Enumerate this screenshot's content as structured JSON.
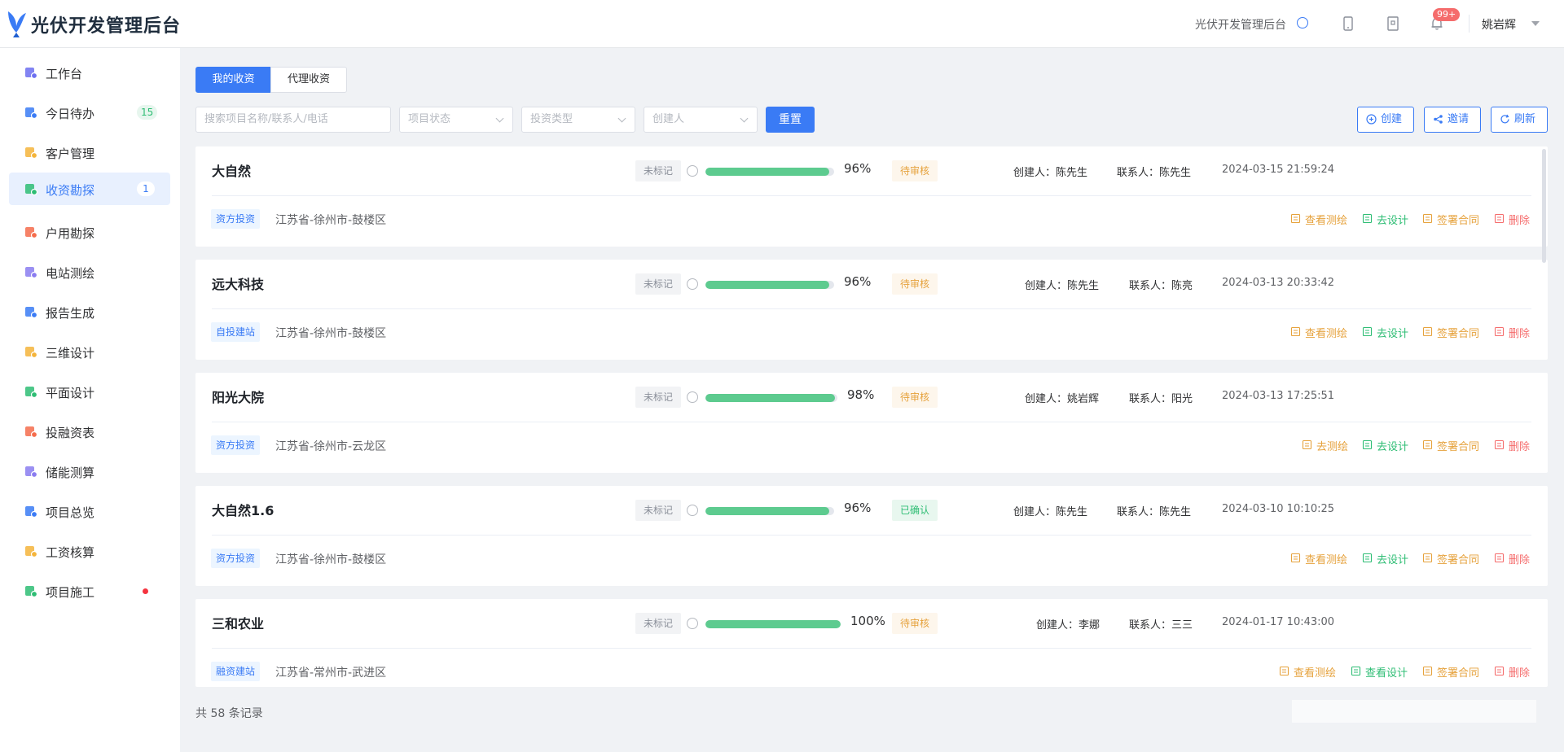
{
  "app": {
    "title": "光伏开发管理后台",
    "system_name": "光伏开发管理后台",
    "notification_badge": "99+",
    "user_name": "姚岩辉"
  },
  "sidebar": {
    "items": [
      {
        "label": "工作台",
        "icon": "home-icon",
        "color": "#6c6ff0"
      },
      {
        "label": "今日待办",
        "icon": "todo-icon",
        "color": "#3a7bf5",
        "count": "15"
      },
      {
        "label": "客户管理",
        "icon": "customer-icon",
        "color": "#f4b43b"
      },
      {
        "label": "收资勘探",
        "icon": "survey-doc-icon",
        "color": "#2ebd74",
        "count": "1"
      },
      {
        "label": "户用勘探",
        "icon": "household-icon",
        "color": "#f56c4c"
      },
      {
        "label": "电站测绘",
        "icon": "station-map-icon",
        "color": "#8a7cf0"
      },
      {
        "label": "报告生成",
        "icon": "report-icon",
        "color": "#3a7bf5"
      },
      {
        "label": "三维设计",
        "icon": "cube-icon",
        "color": "#f4b43b"
      },
      {
        "label": "平面设计",
        "icon": "layout-icon",
        "color": "#2ebd74"
      },
      {
        "label": "投融资表",
        "icon": "finance-icon",
        "color": "#f56c4c"
      },
      {
        "label": "储能测算",
        "icon": "calculator-icon",
        "color": "#8a7cf0"
      },
      {
        "label": "项目总览",
        "icon": "layers-icon",
        "color": "#3a7bf5"
      },
      {
        "label": "工资核算",
        "icon": "salary-icon",
        "color": "#f4b43b"
      },
      {
        "label": "项目施工",
        "icon": "construction-icon",
        "color": "#2ebd74"
      }
    ]
  },
  "tabs": [
    {
      "label": "我的收资"
    },
    {
      "label": "代理收资"
    }
  ],
  "filters": {
    "search_placeholder": "搜索项目名称/联系人/电话",
    "status_placeholder": "项目状态",
    "invest_placeholder": "投资类型",
    "creator_placeholder": "创建人",
    "reset_label": "重置",
    "create_label": "创建",
    "invite_label": "邀请",
    "refresh_label": "刷新"
  },
  "projects": [
    {
      "name": "大自然",
      "mark": "未标记",
      "progress": 0.96,
      "progress_text": "96%",
      "status": "待审核",
      "status_type": "pending",
      "creator": "创建人：陈先生",
      "contact": "联系人：陈先生",
      "date": "2024-03-15 21:59:24",
      "invest_type": "资方投资",
      "address": "江苏省-徐州市-鼓楼区",
      "actions": [
        "查看测绘",
        "去设计",
        "签署合同",
        "删除"
      ]
    },
    {
      "name": "远大科技",
      "mark": "未标记",
      "progress": 0.96,
      "progress_text": "96%",
      "status": "待审核",
      "status_type": "pending",
      "creator": "创建人：陈先生",
      "contact": "联系人：陈亮",
      "date": "2024-03-13 20:33:42",
      "invest_type": "自投建站",
      "address": "江苏省-徐州市-鼓楼区",
      "actions": [
        "查看测绘",
        "去设计",
        "签署合同",
        "删除"
      ]
    },
    {
      "name": "阳光大院",
      "mark": "未标记",
      "progress": 0.98,
      "progress_text": "98%",
      "status": "待审核",
      "status_type": "pending",
      "creator": "创建人：姚岩辉",
      "contact": "联系人：阳光",
      "date": "2024-03-13 17:25:51",
      "invest_type": "资方投资",
      "address": "江苏省-徐州市-云龙区",
      "actions": [
        "去测绘",
        "去设计",
        "签署合同",
        "删除"
      ]
    },
    {
      "name": "大自然1.6",
      "mark": "未标记",
      "progress": 0.96,
      "progress_text": "96%",
      "status": "已确认",
      "status_type": "confirmed",
      "creator": "创建人：陈先生",
      "contact": "联系人：陈先生",
      "date": "2024-03-10 10:10:25",
      "invest_type": "资方投资",
      "address": "江苏省-徐州市-鼓楼区",
      "actions": [
        "查看测绘",
        "去设计",
        "签署合同",
        "删除"
      ]
    },
    {
      "name": "三和农业",
      "mark": "未标记",
      "progress": 1.0,
      "progress_text": "100%",
      "status": "待审核",
      "status_type": "pending",
      "creator": "创建人：李娜",
      "contact": "联系人：三三",
      "date": "2024-01-17 10:43:00",
      "invest_type": "融资建站",
      "address": "江苏省-常州市-武进区",
      "actions": [
        "查看测绘",
        "查看设计",
        "签署合同",
        "删除"
      ]
    }
  ],
  "footer": {
    "total": "共 58 条记录"
  }
}
